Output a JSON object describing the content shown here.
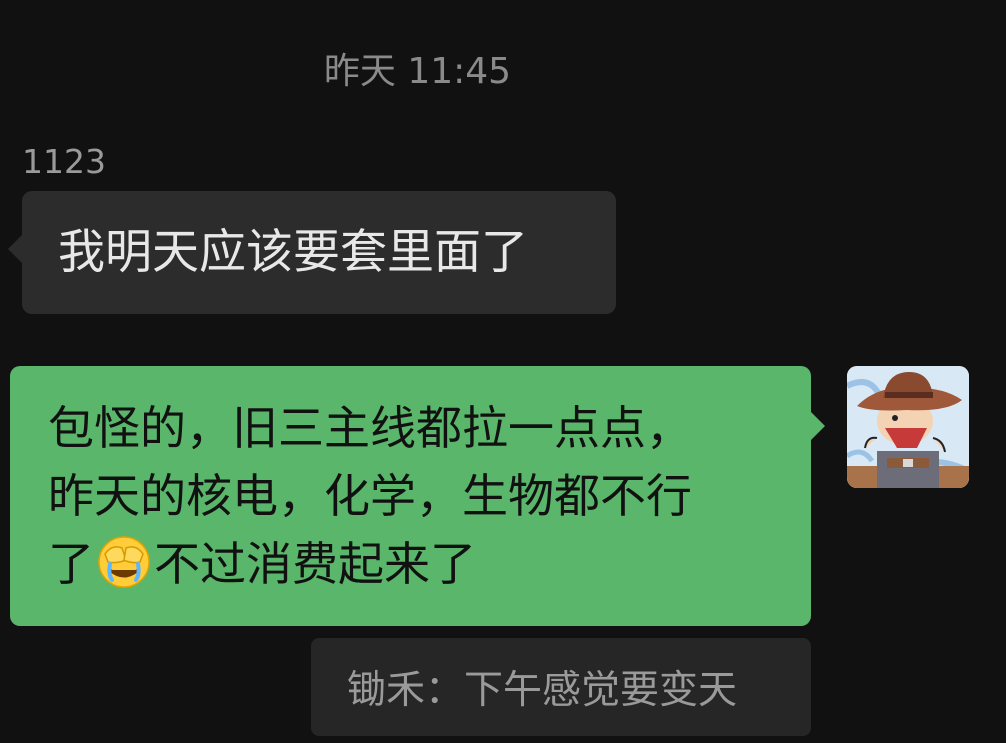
{
  "chat": {
    "timestamp": "昨天 11:45",
    "incoming": {
      "sender_name": "1123",
      "text": "我明天应该要套里面了"
    },
    "outgoing": {
      "line1": "包怪的，旧三主线都拉一点点，",
      "line2": "昨天的核电，化学，生物都不行",
      "line3_before": "了",
      "emoji": "facepalm-crying-emoji",
      "line3_after": "不过消费起来了"
    },
    "quote": {
      "text": "锄禾：下午感觉要变天"
    }
  },
  "colors": {
    "background": "#111111",
    "incoming_bubble": "#2c2c2c",
    "outgoing_bubble": "#5ab66a",
    "quote_bubble": "#262626"
  }
}
